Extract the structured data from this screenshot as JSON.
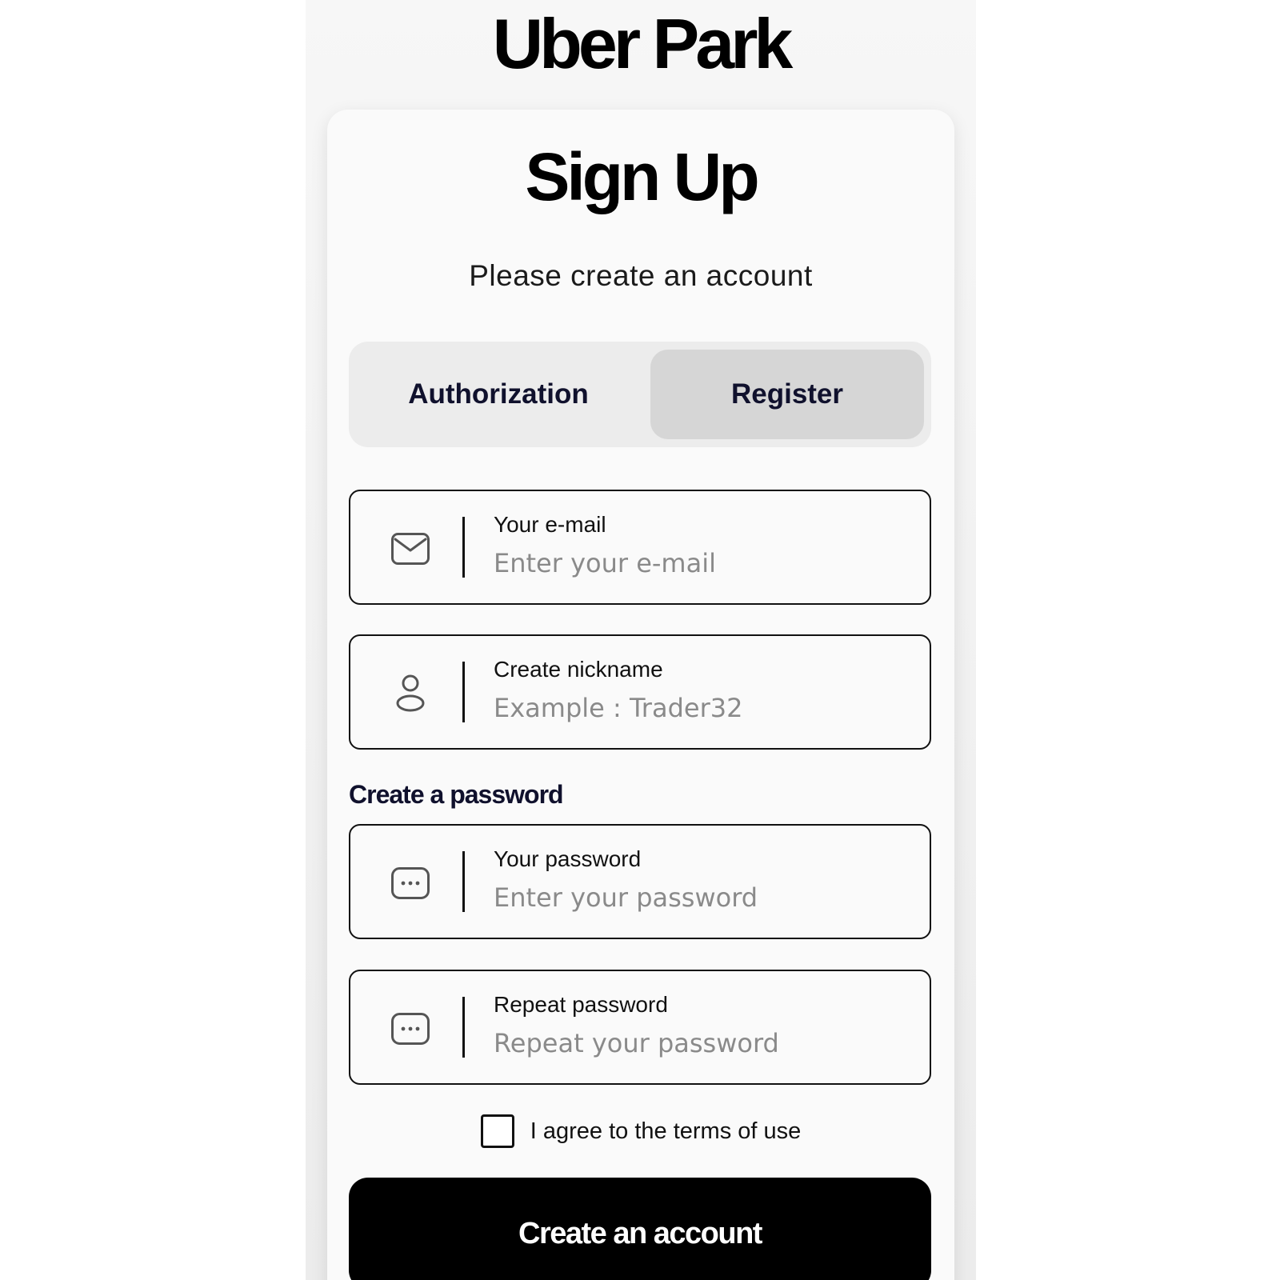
{
  "app": {
    "title": "Uber Park"
  },
  "card": {
    "heading": "Sign Up",
    "subtitle": "Please create an account"
  },
  "tabs": [
    {
      "label": "Authorization",
      "active": false
    },
    {
      "label": "Register",
      "active": true
    }
  ],
  "fields": {
    "email": {
      "icon": "mail-icon",
      "label": "Your e-mail",
      "placeholder": "Enter your e-mail",
      "value": ""
    },
    "nickname": {
      "icon": "user-icon",
      "label": "Create nickname",
      "placeholder": "Example : Trader32",
      "value": ""
    },
    "password": {
      "icon": "password-icon",
      "label": "Your password",
      "placeholder": "Enter your password",
      "value": ""
    },
    "repeat_password": {
      "icon": "password-icon",
      "label": "Repeat password",
      "placeholder": "Repeat your password",
      "value": ""
    }
  },
  "password_section": {
    "label": "Create a password"
  },
  "terms": {
    "label": "I agree to the terms of use",
    "checked": false
  },
  "submit": {
    "label": "Create an account"
  },
  "colors": {
    "primary": "#000000",
    "tab_text": "#10112d",
    "active_tab_bg": "#d6d6d6",
    "tabs_bg": "#ececec",
    "card_bg": "#fafafa"
  }
}
